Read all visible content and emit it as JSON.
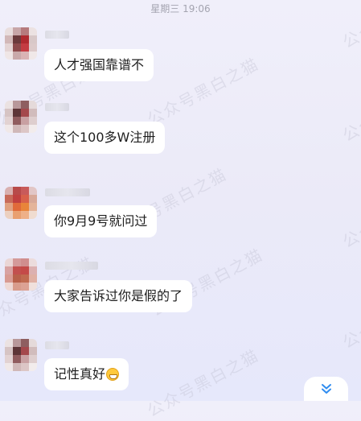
{
  "status": {
    "timestamp": "星期三 19:06"
  },
  "watermark": {
    "text": "公众号黑白之猫"
  },
  "messages": [
    {
      "text": "人才强国靠谱不"
    },
    {
      "text": "这个100多W注册"
    },
    {
      "text": "你9月9号就问过"
    },
    {
      "text": "大家告诉过你是假的了"
    },
    {
      "text": "记性真好",
      "emoji": "grinning-face"
    }
  ],
  "controls": {
    "scroll_icon": "double-chevron-down-icon",
    "accent_color": "#2f8cf0"
  }
}
